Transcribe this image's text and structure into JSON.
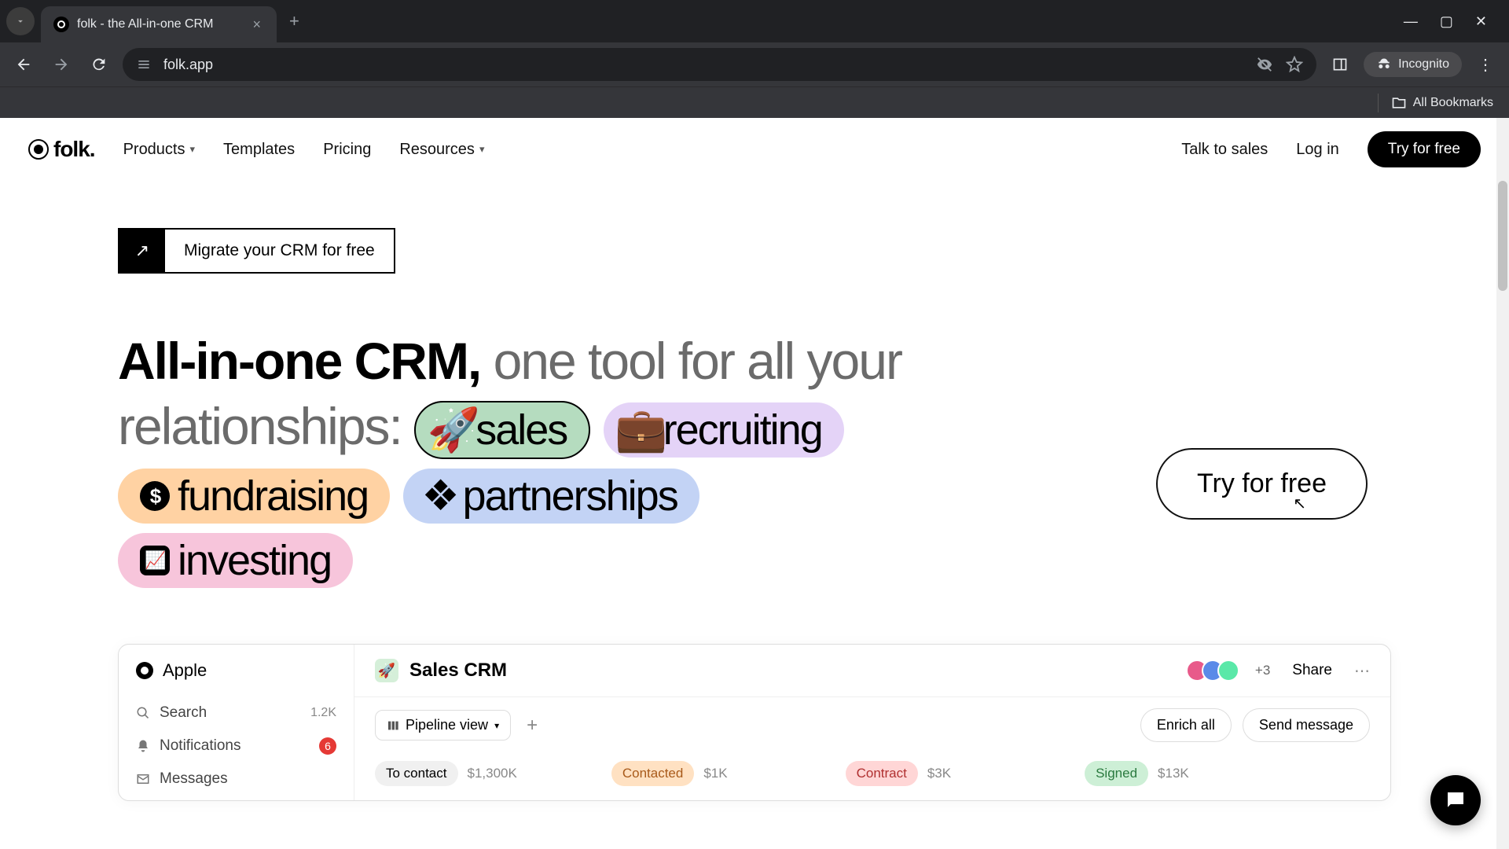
{
  "browser": {
    "tab_title": "folk - the All-in-one CRM",
    "url": "folk.app",
    "incognito_label": "Incognito",
    "all_bookmarks": "All Bookmarks"
  },
  "header": {
    "logo": "folk.",
    "nav": {
      "products": "Products",
      "templates": "Templates",
      "pricing": "Pricing",
      "resources": "Resources"
    },
    "talk_to_sales": "Talk to sales",
    "log_in": "Log in",
    "try_for_free": "Try for free"
  },
  "hero": {
    "migrate": "Migrate your CRM for free",
    "heading_bold": "All-in-one CRM,",
    "heading_light": " one tool for all your relationships:",
    "pills": {
      "sales": "sales",
      "recruiting": "recruiting",
      "fundraising": "fundraising",
      "partnerships": "partnerships",
      "investing": "investing"
    },
    "try_for_free": "Try for free"
  },
  "app": {
    "workspace": "Apple",
    "sidebar": {
      "search": "Search",
      "search_count": "1.2K",
      "notifications": "Notifications",
      "notifications_badge": "6",
      "messages": "Messages"
    },
    "title": "Sales CRM",
    "plus_users": "+3",
    "share": "Share",
    "view_label": "Pipeline view",
    "enrich": "Enrich all",
    "send": "Send message",
    "columns": {
      "to_contact": {
        "label": "To contact",
        "amount": "$1,300K"
      },
      "contacted": {
        "label": "Contacted",
        "amount": "$1K"
      },
      "contract": {
        "label": "Contract",
        "amount": "$3K"
      },
      "signed": {
        "label": "Signed",
        "amount": "$13K"
      }
    }
  }
}
